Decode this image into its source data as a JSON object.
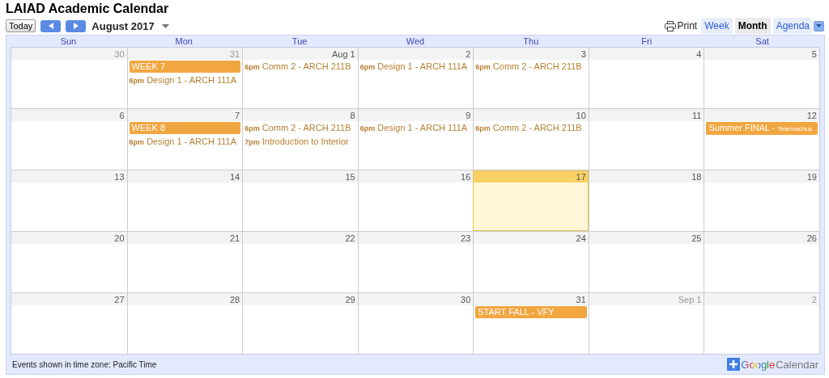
{
  "title": "LAIAD Academic Calendar",
  "toolbar": {
    "today": "Today",
    "month_label": "August 2017",
    "print": "Print",
    "views": [
      {
        "label": "Week",
        "selected": false
      },
      {
        "label": "Month",
        "selected": true
      },
      {
        "label": "Agenda",
        "selected": false
      }
    ]
  },
  "weekdays": [
    "Sun",
    "Mon",
    "Tue",
    "Wed",
    "Thu",
    "Fri",
    "Sat"
  ],
  "weeks": [
    {
      "days": [
        {
          "label": "30",
          "other_month": true,
          "today": false
        },
        {
          "label": "31",
          "other_month": true,
          "today": false,
          "events": [
            {
              "kind": "allday",
              "title": "WEEK 7"
            },
            {
              "kind": "timed",
              "time": "6pm",
              "title": "Design 1 - ARCH 111A"
            }
          ]
        },
        {
          "label": "Aug 1",
          "other_month": false,
          "today": false,
          "events": [
            {
              "kind": "timed",
              "time": "6pm",
              "title": "Comm 2 - ARCH 211B"
            }
          ]
        },
        {
          "label": "2",
          "other_month": false,
          "today": false,
          "events": [
            {
              "kind": "timed",
              "time": "6pm",
              "title": "Design 1 - ARCH 111A"
            }
          ]
        },
        {
          "label": "3",
          "other_month": false,
          "today": false,
          "events": [
            {
              "kind": "timed",
              "time": "6pm",
              "title": "Comm 2 - ARCH 211B"
            }
          ]
        },
        {
          "label": "4",
          "other_month": false,
          "today": false
        },
        {
          "label": "5",
          "other_month": false,
          "today": false
        }
      ]
    },
    {
      "days": [
        {
          "label": "6",
          "other_month": false,
          "today": false
        },
        {
          "label": "7",
          "other_month": false,
          "today": false,
          "events": [
            {
              "kind": "allday",
              "title": "WEEK 8"
            },
            {
              "kind": "timed",
              "time": "6pm",
              "title": "Design 1 - ARCH 111A"
            }
          ]
        },
        {
          "label": "8",
          "other_month": false,
          "today": false,
          "events": [
            {
              "kind": "timed",
              "time": "6pm",
              "title": "Comm 2 - ARCH 211B"
            },
            {
              "kind": "timed",
              "time": "7pm",
              "title": "Introduction to Interior"
            }
          ]
        },
        {
          "label": "9",
          "other_month": false,
          "today": false,
          "events": [
            {
              "kind": "timed",
              "time": "6pm",
              "title": "Design 1 - ARCH 111A"
            }
          ]
        },
        {
          "label": "10",
          "other_month": false,
          "today": false,
          "events": [
            {
              "kind": "timed",
              "time": "6pm",
              "title": "Comm 2 - ARCH 211B"
            }
          ]
        },
        {
          "label": "11",
          "other_month": false,
          "today": false
        },
        {
          "label": "12",
          "other_month": false,
          "today": false,
          "events": [
            {
              "kind": "allday",
              "title": "Summer FINAL -",
              "detail": "Telemachus"
            }
          ]
        }
      ]
    },
    {
      "days": [
        {
          "label": "13",
          "other_month": false,
          "today": false
        },
        {
          "label": "14",
          "other_month": false,
          "today": false
        },
        {
          "label": "15",
          "other_month": false,
          "today": false
        },
        {
          "label": "16",
          "other_month": false,
          "today": false
        },
        {
          "label": "17",
          "other_month": false,
          "today": true
        },
        {
          "label": "18",
          "other_month": false,
          "today": false
        },
        {
          "label": "19",
          "other_month": false,
          "today": false
        }
      ]
    },
    {
      "days": [
        {
          "label": "20",
          "other_month": false,
          "today": false
        },
        {
          "label": "21",
          "other_month": false,
          "today": false
        },
        {
          "label": "22",
          "other_month": false,
          "today": false
        },
        {
          "label": "23",
          "other_month": false,
          "today": false
        },
        {
          "label": "24",
          "other_month": false,
          "today": false
        },
        {
          "label": "25",
          "other_month": false,
          "today": false
        },
        {
          "label": "26",
          "other_month": false,
          "today": false
        }
      ]
    },
    {
      "days": [
        {
          "label": "27",
          "other_month": false,
          "today": false
        },
        {
          "label": "28",
          "other_month": false,
          "today": false
        },
        {
          "label": "29",
          "other_month": false,
          "today": false
        },
        {
          "label": "30",
          "other_month": false,
          "today": false
        },
        {
          "label": "31",
          "other_month": false,
          "today": false,
          "events": [
            {
              "kind": "allday",
              "title": "START FALL - VFY"
            }
          ]
        },
        {
          "label": "Sep 1",
          "other_month": true,
          "today": false
        },
        {
          "label": "2",
          "other_month": true,
          "today": false
        }
      ]
    }
  ],
  "footer": {
    "timezone": "Events shown in time zone: Pacific Time",
    "brand_google": "Google",
    "brand_calendar": "Calendar"
  }
}
